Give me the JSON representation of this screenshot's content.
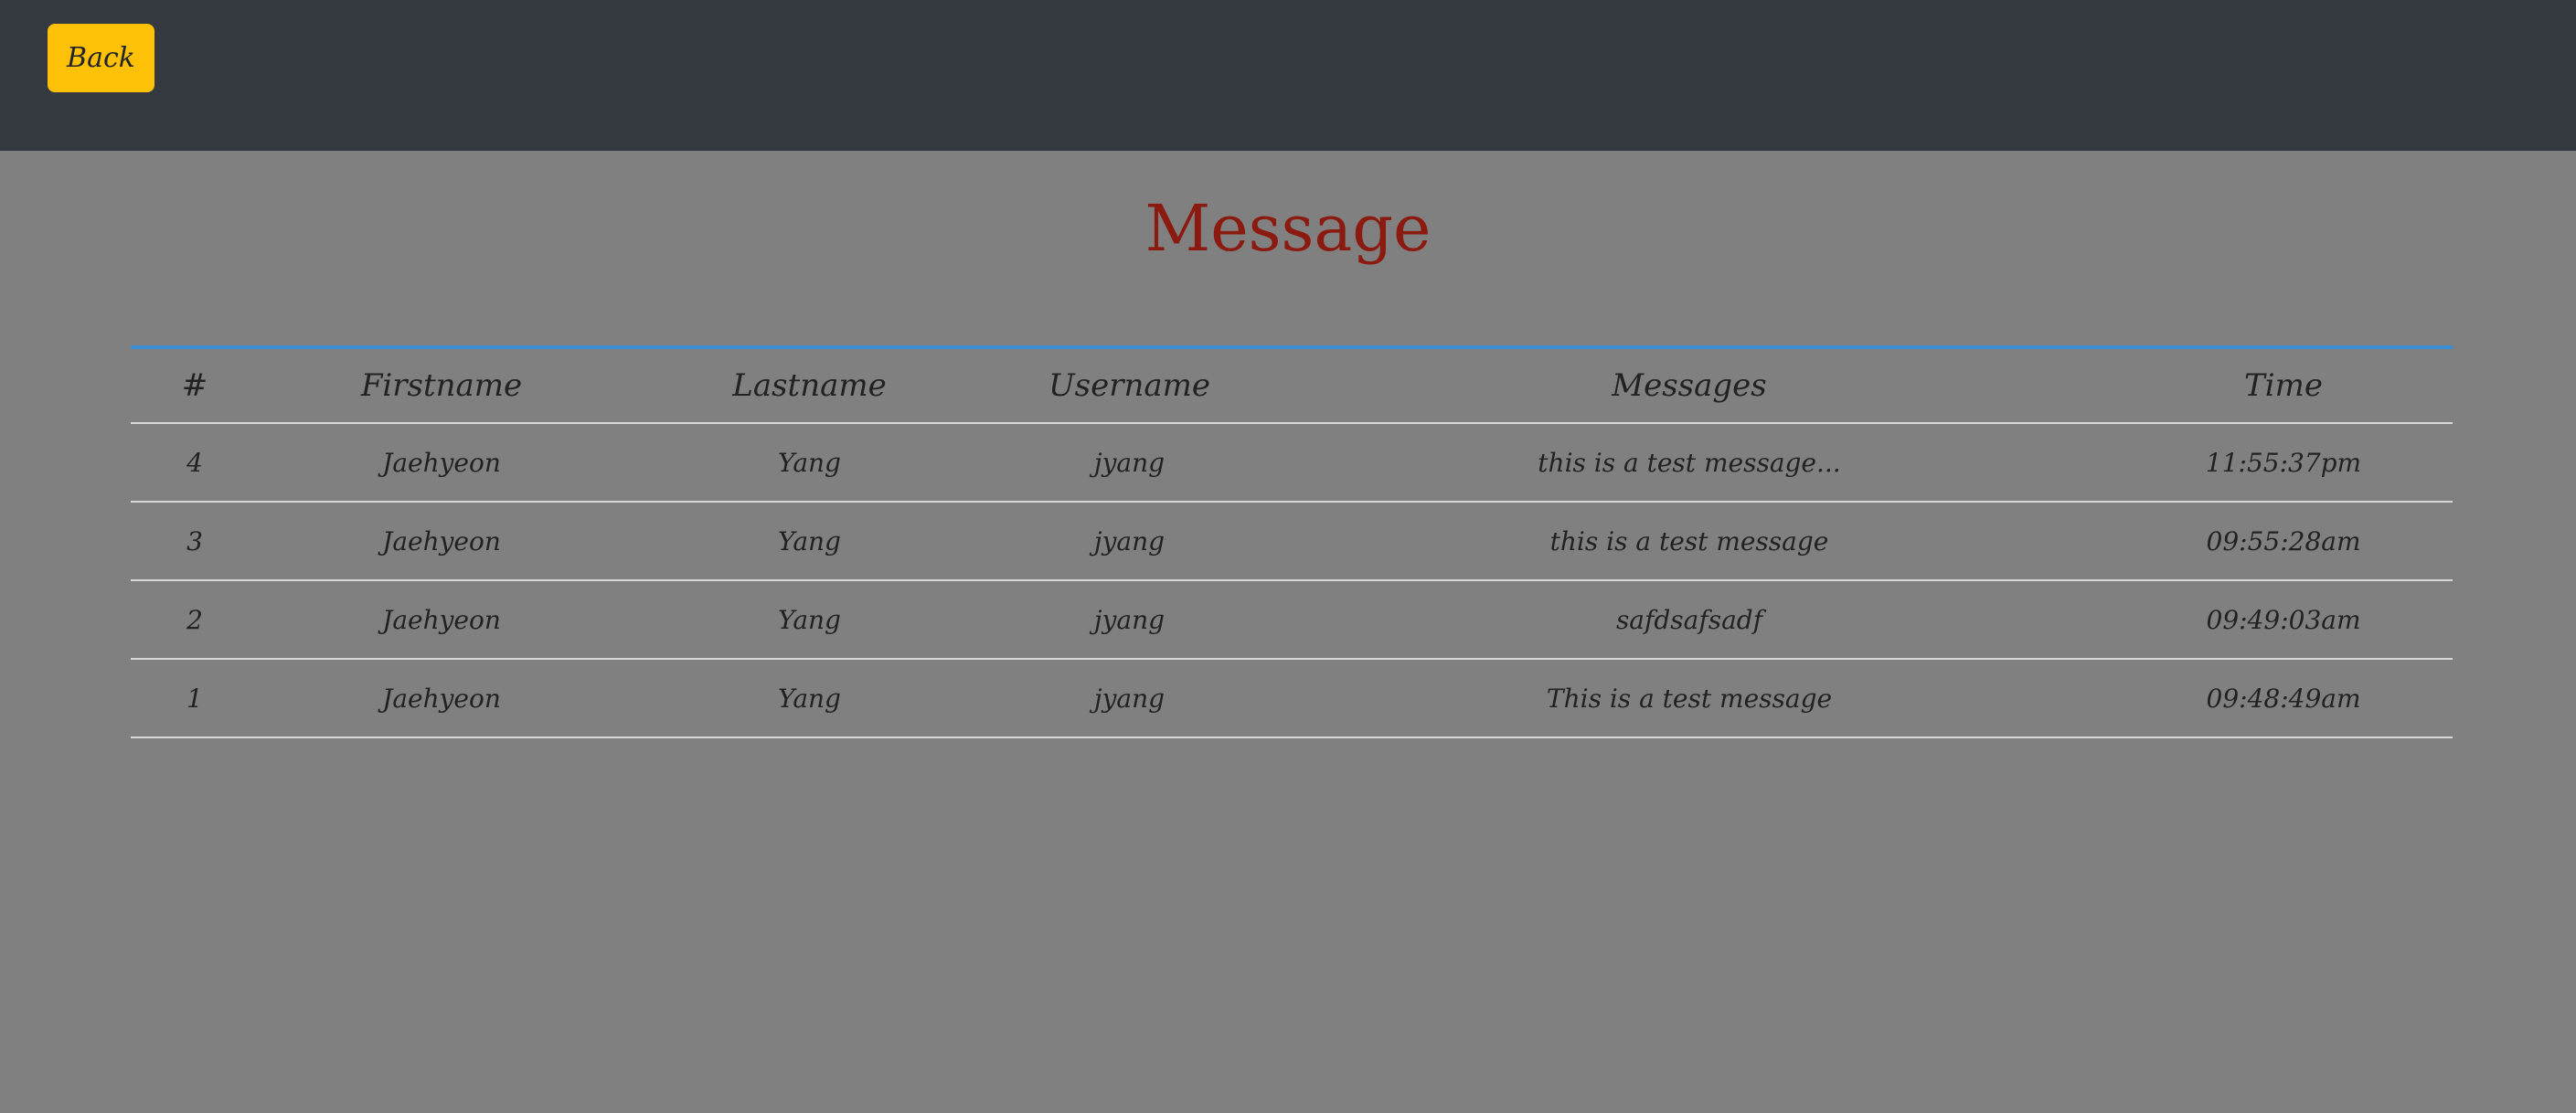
{
  "header": {
    "back_label": "Back"
  },
  "page": {
    "title": "Message"
  },
  "table": {
    "columns": [
      "#",
      "Firstname",
      "Lastname",
      "Username",
      "Messages",
      "Time"
    ],
    "rows": [
      {
        "num": "4",
        "firstname": "Jaehyeon",
        "lastname": "Yang",
        "username": "jyang",
        "message": "this is a test message...",
        "time": "11:55:37pm"
      },
      {
        "num": "3",
        "firstname": "Jaehyeon",
        "lastname": "Yang",
        "username": "jyang",
        "message": "this is a test message",
        "time": "09:55:28am"
      },
      {
        "num": "2",
        "firstname": "Jaehyeon",
        "lastname": "Yang",
        "username": "jyang",
        "message": "safdsafsadf",
        "time": "09:49:03am"
      },
      {
        "num": "1",
        "firstname": "Jaehyeon",
        "lastname": "Yang",
        "username": "jyang",
        "message": "This is a test message",
        "time": "09:48:49am"
      }
    ]
  },
  "colors": {
    "topbar": "#343a40",
    "background": "#808080",
    "back_button": "#ffc107",
    "title": "#8b1a10",
    "table_accent": "#3a8fd6"
  }
}
